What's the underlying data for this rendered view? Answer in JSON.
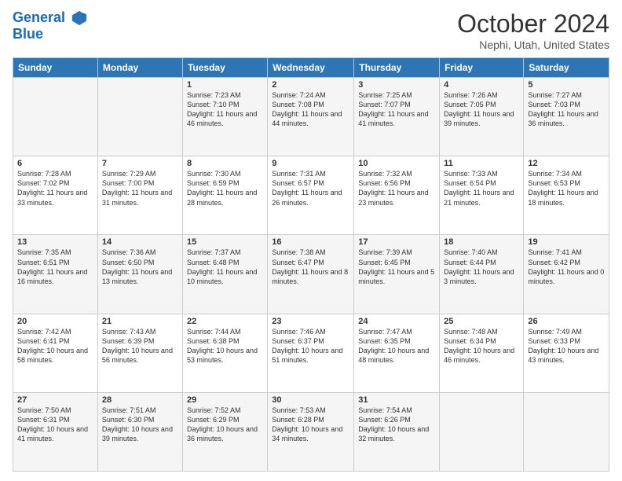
{
  "header": {
    "logo_line1": "General",
    "logo_line2": "Blue",
    "month": "October 2024",
    "location": "Nephi, Utah, United States"
  },
  "columns": [
    "Sunday",
    "Monday",
    "Tuesday",
    "Wednesday",
    "Thursday",
    "Friday",
    "Saturday"
  ],
  "weeks": [
    [
      {
        "day": "",
        "info": ""
      },
      {
        "day": "",
        "info": ""
      },
      {
        "day": "1",
        "info": "Sunrise: 7:23 AM\nSunset: 7:10 PM\nDaylight: 11 hours and 46 minutes."
      },
      {
        "day": "2",
        "info": "Sunrise: 7:24 AM\nSunset: 7:08 PM\nDaylight: 11 hours and 44 minutes."
      },
      {
        "day": "3",
        "info": "Sunrise: 7:25 AM\nSunset: 7:07 PM\nDaylight: 11 hours and 41 minutes."
      },
      {
        "day": "4",
        "info": "Sunrise: 7:26 AM\nSunset: 7:05 PM\nDaylight: 11 hours and 39 minutes."
      },
      {
        "day": "5",
        "info": "Sunrise: 7:27 AM\nSunset: 7:03 PM\nDaylight: 11 hours and 36 minutes."
      }
    ],
    [
      {
        "day": "6",
        "info": "Sunrise: 7:28 AM\nSunset: 7:02 PM\nDaylight: 11 hours and 33 minutes."
      },
      {
        "day": "7",
        "info": "Sunrise: 7:29 AM\nSunset: 7:00 PM\nDaylight: 11 hours and 31 minutes."
      },
      {
        "day": "8",
        "info": "Sunrise: 7:30 AM\nSunset: 6:59 PM\nDaylight: 11 hours and 28 minutes."
      },
      {
        "day": "9",
        "info": "Sunrise: 7:31 AM\nSunset: 6:57 PM\nDaylight: 11 hours and 26 minutes."
      },
      {
        "day": "10",
        "info": "Sunrise: 7:32 AM\nSunset: 6:56 PM\nDaylight: 11 hours and 23 minutes."
      },
      {
        "day": "11",
        "info": "Sunrise: 7:33 AM\nSunset: 6:54 PM\nDaylight: 11 hours and 21 minutes."
      },
      {
        "day": "12",
        "info": "Sunrise: 7:34 AM\nSunset: 6:53 PM\nDaylight: 11 hours and 18 minutes."
      }
    ],
    [
      {
        "day": "13",
        "info": "Sunrise: 7:35 AM\nSunset: 6:51 PM\nDaylight: 11 hours and 16 minutes."
      },
      {
        "day": "14",
        "info": "Sunrise: 7:36 AM\nSunset: 6:50 PM\nDaylight: 11 hours and 13 minutes."
      },
      {
        "day": "15",
        "info": "Sunrise: 7:37 AM\nSunset: 6:48 PM\nDaylight: 11 hours and 10 minutes."
      },
      {
        "day": "16",
        "info": "Sunrise: 7:38 AM\nSunset: 6:47 PM\nDaylight: 11 hours and 8 minutes."
      },
      {
        "day": "17",
        "info": "Sunrise: 7:39 AM\nSunset: 6:45 PM\nDaylight: 11 hours and 5 minutes."
      },
      {
        "day": "18",
        "info": "Sunrise: 7:40 AM\nSunset: 6:44 PM\nDaylight: 11 hours and 3 minutes."
      },
      {
        "day": "19",
        "info": "Sunrise: 7:41 AM\nSunset: 6:42 PM\nDaylight: 11 hours and 0 minutes."
      }
    ],
    [
      {
        "day": "20",
        "info": "Sunrise: 7:42 AM\nSunset: 6:41 PM\nDaylight: 10 hours and 58 minutes."
      },
      {
        "day": "21",
        "info": "Sunrise: 7:43 AM\nSunset: 6:39 PM\nDaylight: 10 hours and 56 minutes."
      },
      {
        "day": "22",
        "info": "Sunrise: 7:44 AM\nSunset: 6:38 PM\nDaylight: 10 hours and 53 minutes."
      },
      {
        "day": "23",
        "info": "Sunrise: 7:46 AM\nSunset: 6:37 PM\nDaylight: 10 hours and 51 minutes."
      },
      {
        "day": "24",
        "info": "Sunrise: 7:47 AM\nSunset: 6:35 PM\nDaylight: 10 hours and 48 minutes."
      },
      {
        "day": "25",
        "info": "Sunrise: 7:48 AM\nSunset: 6:34 PM\nDaylight: 10 hours and 46 minutes."
      },
      {
        "day": "26",
        "info": "Sunrise: 7:49 AM\nSunset: 6:33 PM\nDaylight: 10 hours and 43 minutes."
      }
    ],
    [
      {
        "day": "27",
        "info": "Sunrise: 7:50 AM\nSunset: 6:31 PM\nDaylight: 10 hours and 41 minutes."
      },
      {
        "day": "28",
        "info": "Sunrise: 7:51 AM\nSunset: 6:30 PM\nDaylight: 10 hours and 39 minutes."
      },
      {
        "day": "29",
        "info": "Sunrise: 7:52 AM\nSunset: 6:29 PM\nDaylight: 10 hours and 36 minutes."
      },
      {
        "day": "30",
        "info": "Sunrise: 7:53 AM\nSunset: 6:28 PM\nDaylight: 10 hours and 34 minutes."
      },
      {
        "day": "31",
        "info": "Sunrise: 7:54 AM\nSunset: 6:26 PM\nDaylight: 10 hours and 32 minutes."
      },
      {
        "day": "",
        "info": ""
      },
      {
        "day": "",
        "info": ""
      }
    ]
  ]
}
